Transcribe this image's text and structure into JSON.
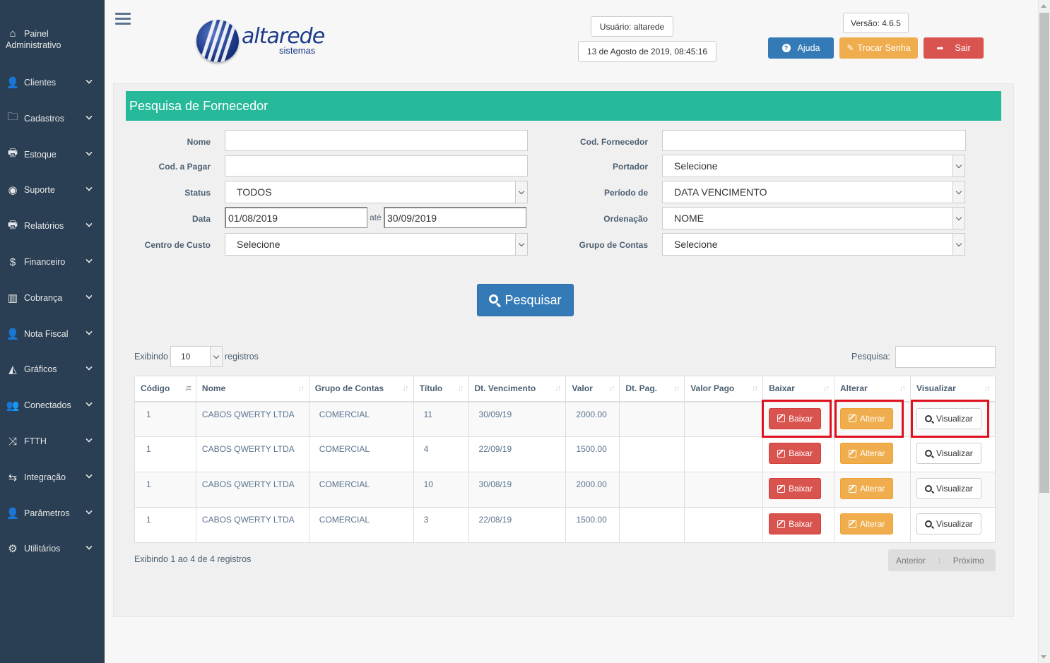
{
  "sidebar": {
    "home": {
      "label_line1": "Painel",
      "label_line2": "Administrativo",
      "icon": "home-icon"
    },
    "items": [
      {
        "label": "Clientes",
        "icon": "user-icon",
        "glyph": "👤"
      },
      {
        "label": "Cadastros",
        "icon": "folder-icon",
        "glyph": "🗀"
      },
      {
        "label": "Estoque",
        "icon": "print-icon",
        "glyph": "🖶"
      },
      {
        "label": "Suporte",
        "icon": "lifebuoy-icon",
        "glyph": "◉"
      },
      {
        "label": "Relatórios",
        "icon": "print-icon",
        "glyph": "🖶"
      },
      {
        "label": "Financeiro",
        "icon": "dollar-icon",
        "glyph": "$"
      },
      {
        "label": "Cobrança",
        "icon": "barcode-icon",
        "glyph": "▥"
      },
      {
        "label": "Nota Fiscal",
        "icon": "user-icon",
        "glyph": "👤"
      },
      {
        "label": "Gráficos",
        "icon": "area-chart-icon",
        "glyph": "◭"
      },
      {
        "label": "Conectados",
        "icon": "users-icon",
        "glyph": "👥"
      },
      {
        "label": "FTTH",
        "icon": "random-icon",
        "glyph": "⤨"
      },
      {
        "label": "Integração",
        "icon": "exchange-icon",
        "glyph": "⇆"
      },
      {
        "label": "Parâmetros",
        "icon": "user-icon",
        "glyph": "👤"
      },
      {
        "label": "Utilitários",
        "icon": "cogs-icon",
        "glyph": "⚙"
      }
    ]
  },
  "header": {
    "logo_text": "altarede",
    "logo_sub": "sistemas",
    "user": "Usuário: altarede",
    "datetime": "13 de Agosto de 2019, 08:45:16",
    "version": "Versão: 4.6.5",
    "help_label": "Ajuda",
    "change_password_label": "Trocar Senha",
    "logout_label": "Sair"
  },
  "colors": {
    "sidebar": "#2a3f54",
    "title_bar": "#26b99a",
    "primary": "#337ab7",
    "danger": "#d9534f",
    "warning": "#f0ad4e",
    "highlight": "#e0101e"
  },
  "form": {
    "title": "Pesquisa de Fornecedor",
    "nome_label": "Nome",
    "nome_value": "",
    "cod_pagar_label": "Cod. a Pagar",
    "cod_pagar_value": "",
    "status_label": "Status",
    "status_value": "TODOS",
    "data_label": "Data",
    "data_from": "01/08/2019",
    "ate": "até",
    "data_to": "30/09/2019",
    "centro_label": "Centro de Custo",
    "centro_value": "Selecione",
    "cod_fornecedor_label": "Cod. Fornecedor",
    "cod_fornecedor_value": "",
    "portador_label": "Portador",
    "portador_value": "Selecione",
    "periodo_label": "Período de",
    "periodo_value": "DATA VENCIMENTO",
    "ordenacao_label": "Ordenação",
    "ordenacao_value": "NOME",
    "grupo_label": "Grupo de Contas",
    "grupo_value": "Selecione",
    "search_button": "Pesquisar"
  },
  "table_controls": {
    "show_prefix": "Exibindo",
    "page_length": "10",
    "show_suffix": "registros",
    "search_label": "Pesquisa:",
    "search_value": "",
    "info": "Exibindo 1 ao 4 de 4 registros",
    "prev": "Anterior",
    "page": "1",
    "next": "Próximo"
  },
  "table": {
    "columns": [
      "Código",
      "Nome",
      "Grupo de Contas",
      "Título",
      "Dt. Vencimento",
      "Valor",
      "Dt. Pag.",
      "Valor Pago",
      "Baixar",
      "Alterar",
      "Visualizar"
    ],
    "action_labels": {
      "baixar": "Baixar",
      "alterar": "Alterar",
      "visualizar": "Visualizar"
    },
    "rows": [
      {
        "codigo": "1",
        "nome": "CABOS QWERTY LTDA",
        "grupo": "COMERCIAL",
        "titulo": "11",
        "vencimento": "30/09/19",
        "valor": "2000.00",
        "dt_pag": "",
        "valor_pago": ""
      },
      {
        "codigo": "1",
        "nome": "CABOS QWERTY LTDA",
        "grupo": "COMERCIAL",
        "titulo": "4",
        "vencimento": "22/09/19",
        "valor": "1500.00",
        "dt_pag": "",
        "valor_pago": ""
      },
      {
        "codigo": "1",
        "nome": "CABOS QWERTY LTDA",
        "grupo": "COMERCIAL",
        "titulo": "10",
        "vencimento": "30/08/19",
        "valor": "2000.00",
        "dt_pag": "",
        "valor_pago": ""
      },
      {
        "codigo": "1",
        "nome": "CABOS QWERTY LTDA",
        "grupo": "COMERCIAL",
        "titulo": "3",
        "vencimento": "22/08/19",
        "valor": "1500.00",
        "dt_pag": "",
        "valor_pago": ""
      }
    ]
  }
}
